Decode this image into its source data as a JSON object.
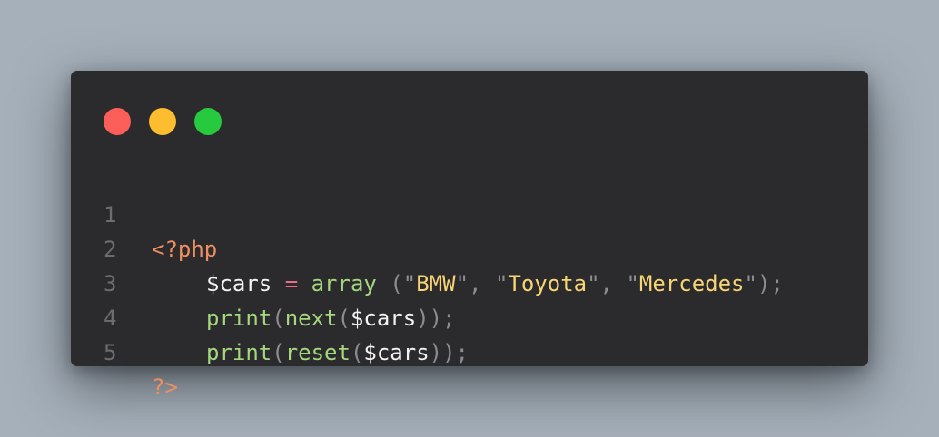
{
  "window": {
    "traffic_lights": {
      "close_color": "#fc5e5a",
      "minimize_color": "#fdbd2e",
      "maximize_color": "#27c93f"
    }
  },
  "code": {
    "lines": [
      {
        "number": "1",
        "tokens": {
          "open_tag": "<?php"
        }
      },
      {
        "number": "2",
        "tokens": {
          "var": "$cars",
          "sp1": " ",
          "op": "=",
          "sp2": " ",
          "fn": "array",
          "sp3": " ",
          "p1": "(",
          "q1": "\"",
          "s1": "BMW",
          "q2": "\"",
          "c1": ",",
          "sp4": " ",
          "q3": "\"",
          "s2": "Toyota",
          "q4": "\"",
          "c2": ",",
          "sp5": " ",
          "q5": "\"",
          "s3": "Mercedes",
          "q6": "\"",
          "p2": ");"
        }
      },
      {
        "number": "3",
        "tokens": {
          "fn1": "print",
          "p1": "(",
          "fn2": "next",
          "p2": "(",
          "var": "$cars",
          "p3": "));"
        }
      },
      {
        "number": "4",
        "tokens": {
          "fn1": "print",
          "p1": "(",
          "fn2": "reset",
          "p2": "(",
          "var": "$cars",
          "p3": "));"
        }
      },
      {
        "number": "5",
        "tokens": {
          "close_tag": "?>"
        }
      }
    ]
  }
}
